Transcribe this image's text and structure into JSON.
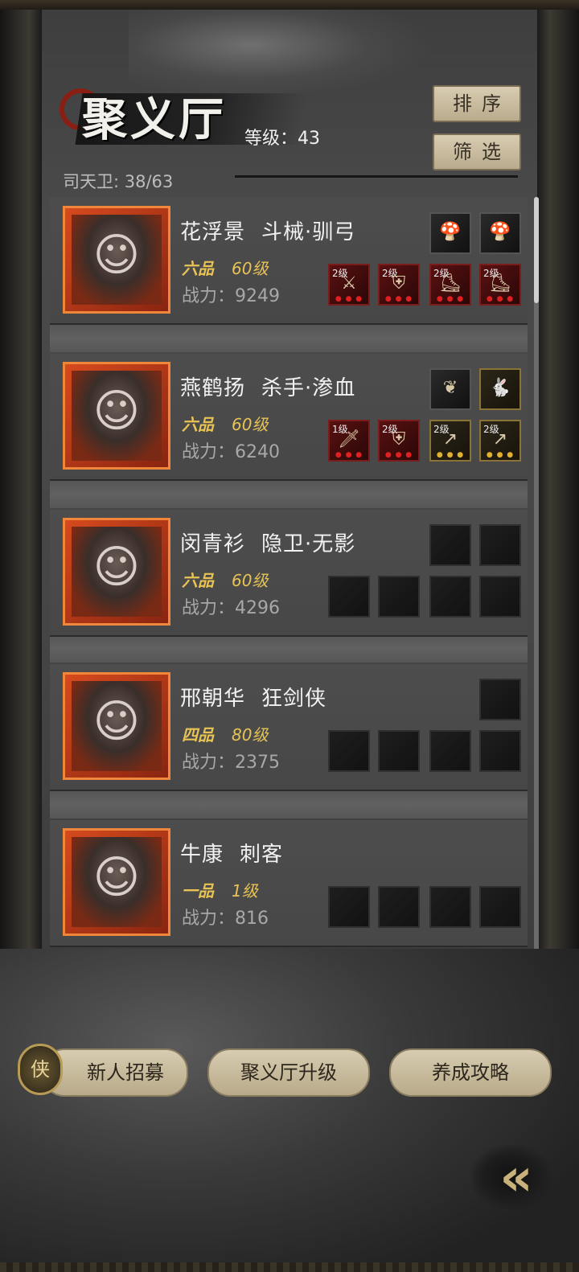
{
  "header": {
    "title": "聚义厅",
    "level_label": "等级：43",
    "guard_count": "司天卫: 38/63",
    "sort_label": "排序",
    "filter_label": "筛选"
  },
  "heroes": [
    {
      "name": "花浮景",
      "class": "斗械·驯弓",
      "grade": "六品",
      "level": "60级",
      "power": "战力：9249",
      "equip": [
        {
          "level": "2级",
          "icon": "crossbow-icon"
        },
        {
          "level": "2级",
          "icon": "armor-icon"
        },
        {
          "level": "2级",
          "icon": "boots-icon"
        },
        {
          "level": "2级",
          "icon": "boots-icon"
        }
      ],
      "accessories": [
        "mushroom-icon",
        "mushroom-icon"
      ]
    },
    {
      "name": "燕鹤扬",
      "class": "杀手·渗血",
      "grade": "六品",
      "level": "60级",
      "power": "战力：6240",
      "equip": [
        {
          "level": "1级",
          "icon": "dagger-icon"
        },
        {
          "level": "2级",
          "icon": "robe-icon"
        },
        {
          "level": "2级",
          "icon": "spear-icon"
        },
        {
          "level": "2级",
          "icon": "spear-icon"
        }
      ],
      "accessories": [
        "fan-icon",
        "rabbit-icon"
      ]
    },
    {
      "name": "闵青衫",
      "class": "隐卫·无影",
      "grade": "六品",
      "level": "60级",
      "power": "战力：4296"
    },
    {
      "name": "邢朝华",
      "class": "狂剑侠",
      "grade": "四品",
      "level": "80级",
      "power": "战力：2375"
    },
    {
      "name": "牛康",
      "class": "刺客",
      "grade": "一品",
      "level": "1级",
      "power": "战力：816"
    }
  ],
  "footer": {
    "recruit_badge": "侠",
    "recruit_label": "新人招募",
    "upgrade_label": "聚义厅升级",
    "guide_label": "养成攻略"
  },
  "colors": {
    "grade_gold": "#e8c354",
    "portrait_frame": "#f0863a",
    "button_beige": "#d7ccb1"
  }
}
